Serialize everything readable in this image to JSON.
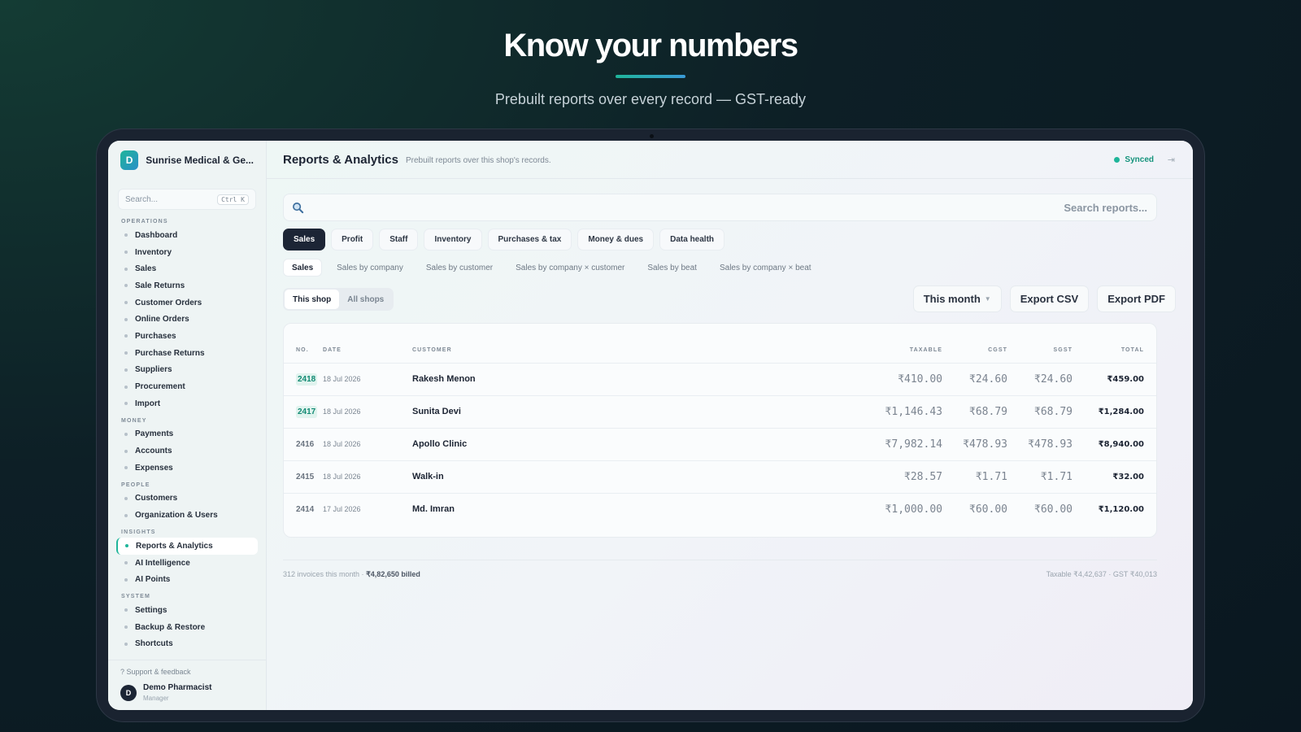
{
  "hero": {
    "title": "Know your numbers",
    "subtitle": "Prebuilt reports over every record — GST-ready"
  },
  "colors": {
    "accent": "#1fb59a",
    "dark": "#1c2535"
  },
  "sidebar": {
    "brand_initial": "D",
    "brand_name": "Sunrise Medical & Ge...",
    "search_placeholder": "Search...",
    "search_shortcut": "Ctrl K",
    "groups": [
      {
        "heading": "OPERATIONS",
        "items": [
          "Dashboard",
          "Inventory",
          "Sales",
          "Sale Returns",
          "Customer Orders",
          "Online Orders",
          "Purchases",
          "Purchase Returns",
          "Suppliers",
          "Procurement",
          "Import"
        ]
      },
      {
        "heading": "MONEY",
        "items": [
          "Payments",
          "Accounts",
          "Expenses"
        ]
      },
      {
        "heading": "PEOPLE",
        "items": [
          "Customers",
          "Organization & Users"
        ]
      },
      {
        "heading": "INSIGHTS",
        "items": [
          "Reports & Analytics",
          "AI Intelligence",
          "AI Points"
        ]
      },
      {
        "heading": "SYSTEM",
        "items": [
          "Settings",
          "Backup & Restore",
          "Shortcuts"
        ]
      }
    ],
    "active_item": "Reports & Analytics",
    "support": "? Support & feedback",
    "user": {
      "initial": "D",
      "name": "Demo Pharmacist",
      "role": "Manager"
    }
  },
  "header": {
    "title": "Reports & Analytics",
    "subtitle": "Prebuilt reports over this shop's records.",
    "sync_status": "Synced"
  },
  "search": {
    "placeholder": "Search reports..."
  },
  "tabs": [
    "Sales",
    "Profit",
    "Staff",
    "Inventory",
    "Purchases & tax",
    "Money & dues",
    "Data health"
  ],
  "active_tab": "Sales",
  "subtabs": [
    "Sales",
    "Sales by company",
    "Sales by customer",
    "Sales by company × customer",
    "Sales by beat",
    "Sales by company × beat"
  ],
  "active_subtab": "Sales",
  "scope": {
    "options": [
      "This shop",
      "All shops"
    ],
    "selected": "This shop"
  },
  "actions": {
    "period": "This month",
    "export_csv": "Export CSV",
    "export_pdf": "Export PDF"
  },
  "table": {
    "columns": [
      "NO.",
      "DATE",
      "CUSTOMER",
      "TAXABLE",
      "CGST",
      "SGST",
      "TOTAL"
    ],
    "rows": [
      {
        "no": "2418",
        "date": "18 Jul 2026",
        "customer": "Rakesh Menon",
        "taxable": "₹410.00",
        "cgst": "₹24.60",
        "sgst": "₹24.60",
        "total": "₹459.00",
        "highlight": true
      },
      {
        "no": "2417",
        "date": "18 Jul 2026",
        "customer": "Sunita Devi",
        "taxable": "₹1,146.43",
        "cgst": "₹68.79",
        "sgst": "₹68.79",
        "total": "₹1,284.00",
        "highlight": true
      },
      {
        "no": "2416",
        "date": "18 Jul 2026",
        "customer": "Apollo Clinic",
        "taxable": "₹7,982.14",
        "cgst": "₹478.93",
        "sgst": "₹478.93",
        "total": "₹8,940.00",
        "highlight": false
      },
      {
        "no": "2415",
        "date": "18 Jul 2026",
        "customer": "Walk-in",
        "taxable": "₹28.57",
        "cgst": "₹1.71",
        "sgst": "₹1.71",
        "total": "₹32.00",
        "highlight": false
      },
      {
        "no": "2414",
        "date": "17 Jul 2026",
        "customer": "Md. Imran",
        "taxable": "₹1,000.00",
        "cgst": "₹60.00",
        "sgst": "₹60.00",
        "total": "₹1,120.00",
        "highlight": false
      }
    ]
  },
  "summary": {
    "invoices": "312 invoices this month ·",
    "billed": "₹4,82,650 billed",
    "tax_summary": "Taxable ₹4,42,637 · GST ₹40,013"
  }
}
